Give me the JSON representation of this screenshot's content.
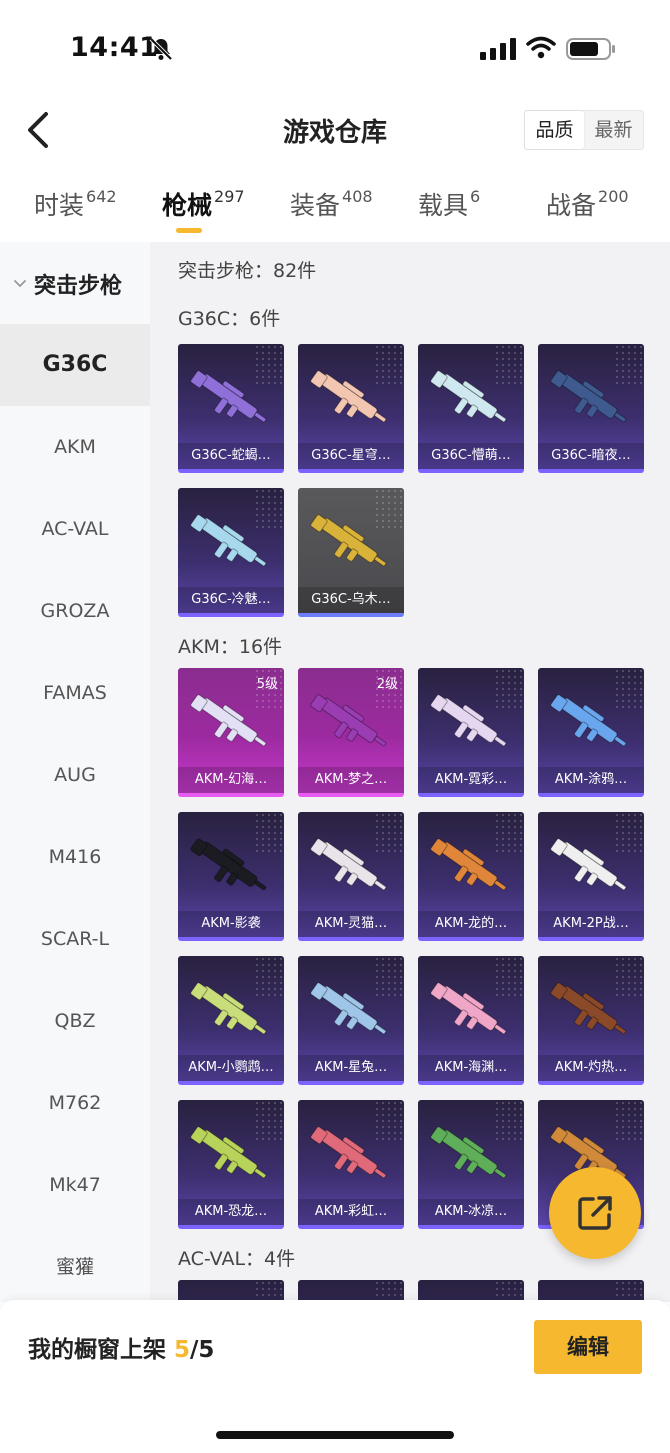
{
  "status": {
    "time": "14:41"
  },
  "header": {
    "title": "游戏仓库",
    "sort_options": [
      "品质",
      "最新"
    ],
    "active_sort": 0
  },
  "tabs": [
    {
      "label": "时装",
      "count": "642"
    },
    {
      "label": "枪械",
      "count": "297"
    },
    {
      "label": "装备",
      "count": "408"
    },
    {
      "label": "载具",
      "count": "6"
    },
    {
      "label": "战备",
      "count": "200"
    }
  ],
  "active_tab": 1,
  "sidebar": {
    "group": "突击步枪",
    "items": [
      "G36C",
      "AKM",
      "AC-VAL",
      "GROZA",
      "FAMAS",
      "AUG",
      "M416",
      "SCAR-L",
      "QBZ",
      "M762",
      "Mk47",
      "蜜獾"
    ],
    "active": 0
  },
  "content": {
    "summary": "突击步枪：82件",
    "sections": [
      {
        "title": "G36C：6件",
        "items": [
          {
            "name": "G36C-蛇蝎…",
            "style": "purple",
            "gun_color": "#8f6fd8"
          },
          {
            "name": "G36C-星穹…",
            "style": "purple",
            "gun_color": "#f2c6b0"
          },
          {
            "name": "G36C-懵萌…",
            "style": "purple",
            "gun_color": "#cfe7ee"
          },
          {
            "name": "G36C-暗夜…",
            "style": "purple",
            "gun_color": "#3f5a8f"
          },
          {
            "name": "G36C-冷魅…",
            "style": "purple",
            "gun_color": "#a8d8ee"
          },
          {
            "name": "G36C-乌木…",
            "style": "grey",
            "gun_color": "#d9b23a"
          }
        ]
      },
      {
        "title": "AKM：16件",
        "items": [
          {
            "name": "AKM-幻海…",
            "style": "pink",
            "level": "5级",
            "gun_color": "#e3e0f5"
          },
          {
            "name": "AKM-梦之…",
            "style": "pink",
            "level": "2级",
            "gun_color": "#9a3db3"
          },
          {
            "name": "AKM-霓彩…",
            "style": "purple",
            "gun_color": "#e6d7f0"
          },
          {
            "name": "AKM-涂鸦…",
            "style": "purple",
            "gun_color": "#6aa6ee"
          },
          {
            "name": "AKM-影袭",
            "style": "purple",
            "gun_color": "#1b1b22"
          },
          {
            "name": "AKM-灵猫…",
            "style": "purple",
            "gun_color": "#e8e4ea"
          },
          {
            "name": "AKM-龙的…",
            "style": "purple",
            "gun_color": "#e0863a"
          },
          {
            "name": "AKM-2P战…",
            "style": "purple",
            "gun_color": "#efefef"
          },
          {
            "name": "AKM-小鹦鹉…",
            "style": "purple",
            "gun_color": "#c9dd7a"
          },
          {
            "name": "AKM-星兔…",
            "style": "purple",
            "gun_color": "#9fc6e8"
          },
          {
            "name": "AKM-海渊…",
            "style": "purple",
            "gun_color": "#f0a6c6"
          },
          {
            "name": "AKM-灼热…",
            "style": "purple",
            "gun_color": "#8a4a2a"
          },
          {
            "name": "AKM-恐龙…",
            "style": "purple",
            "gun_color": "#b7d35a"
          },
          {
            "name": "AKM-彩虹…",
            "style": "purple",
            "gun_color": "#e06a7a"
          },
          {
            "name": "AKM-冰凉…",
            "style": "purple",
            "gun_color": "#5fae5a"
          },
          {
            "name": "",
            "style": "purple",
            "gun_color": "#d08a3a"
          }
        ]
      },
      {
        "title": "AC-VAL：4件",
        "items": [
          {
            "name": "",
            "style": "purple",
            "gun_color": "#777"
          },
          {
            "name": "",
            "style": "purple",
            "gun_color": "#777"
          },
          {
            "name": "",
            "style": "purple",
            "gun_color": "#777"
          },
          {
            "name": "",
            "style": "purple",
            "gun_color": "#777"
          }
        ]
      }
    ]
  },
  "bottom": {
    "label": "我的橱窗上架",
    "current": "5",
    "total": "/5",
    "edit_label": "编辑"
  },
  "colors": {
    "accent": "#f5b82e",
    "card_purple": "#3d2f6f",
    "card_pink": "#9d2aa0"
  }
}
